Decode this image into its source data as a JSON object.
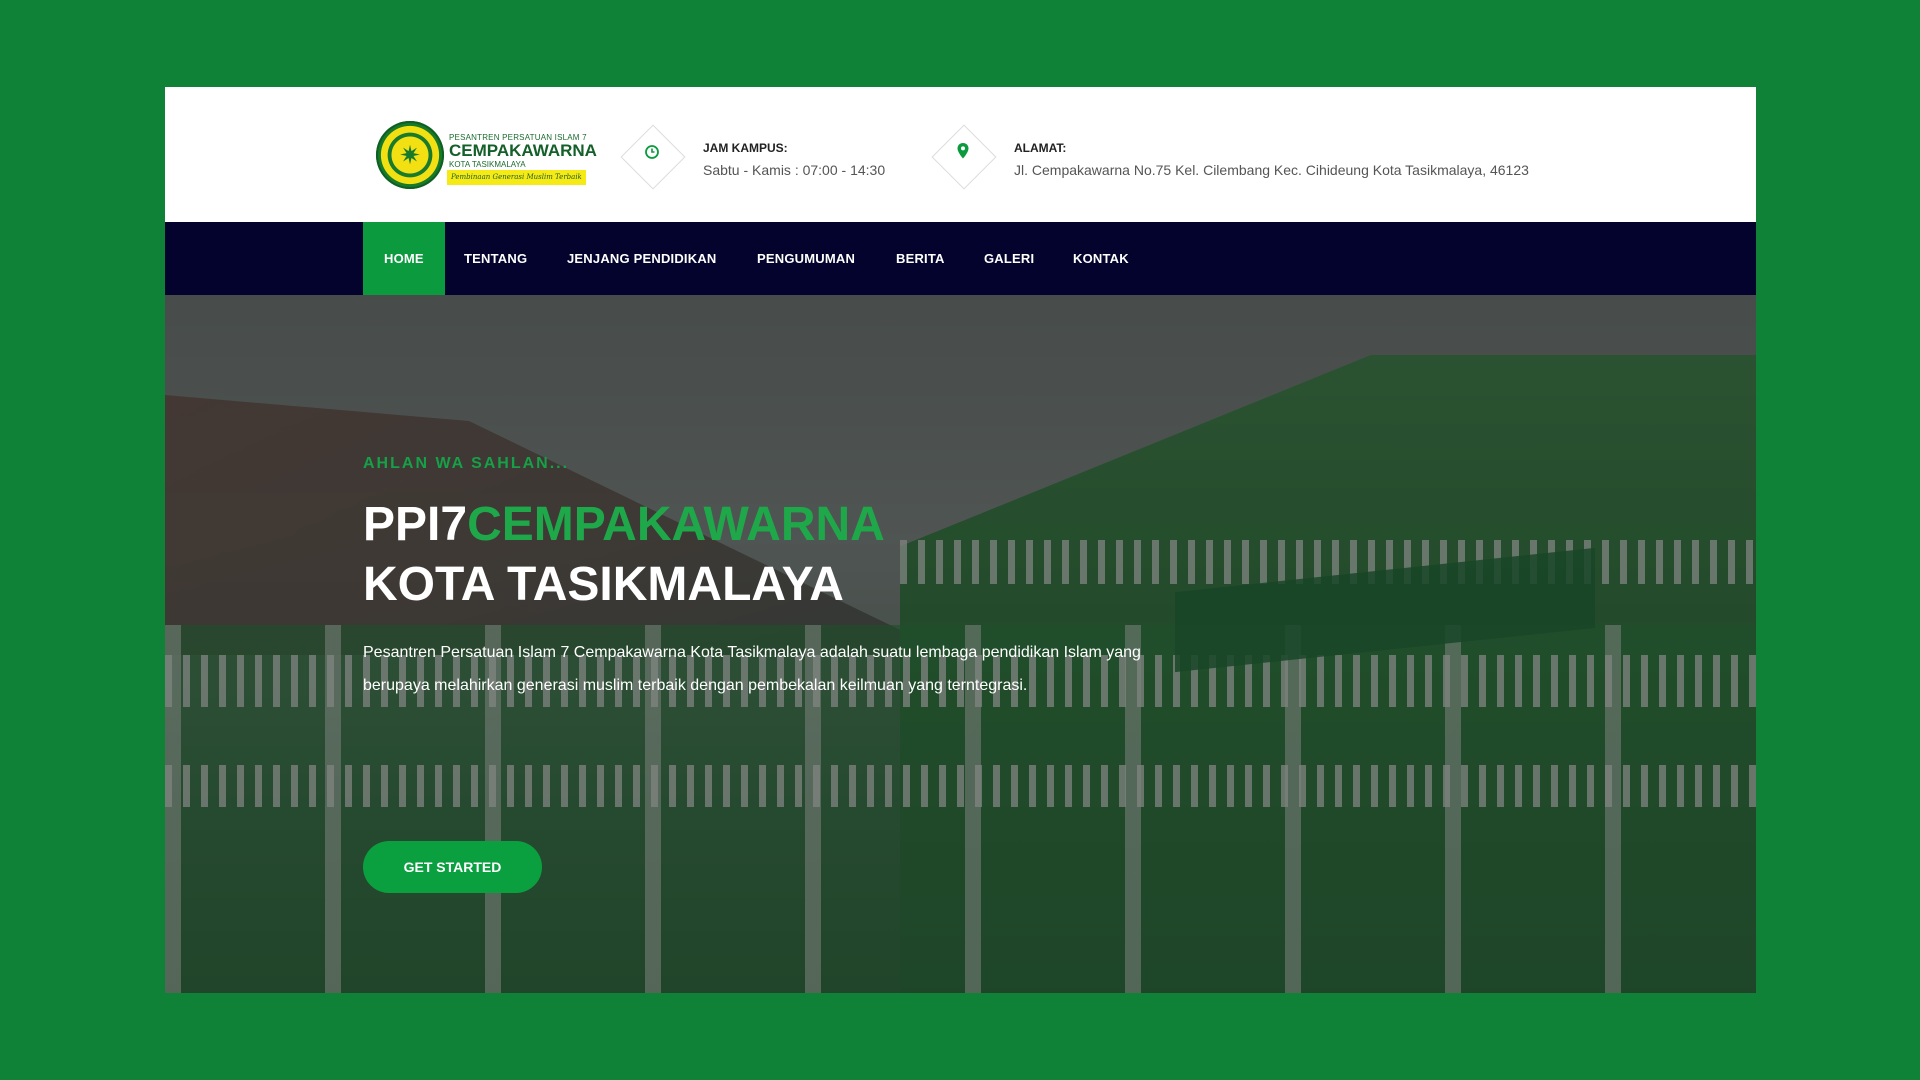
{
  "logo": {
    "line1": "PESANTREN PERSATUAN ISLAM 7",
    "line2": "CEMPAKAWARNA",
    "line3": "KOTA TASIKMALAYA",
    "tagline": "Pembinaan Generasi Muslim Terbaik"
  },
  "header": {
    "campus_hours": {
      "label": "JAM KAMPUS:",
      "value": "Sabtu - Kamis : 07:00 - 14:30",
      "icon": "clock-icon"
    },
    "address": {
      "label": "ALAMAT:",
      "value": "Jl. Cempakawarna No.75 Kel. Cilembang Kec. Cihideung Kota Tasikmalaya, 46123",
      "icon": "map-pin-icon"
    }
  },
  "nav": {
    "items": [
      {
        "label": "HOME",
        "active": true
      },
      {
        "label": "TENTANG"
      },
      {
        "label": "JENJANG PENDIDIKAN"
      },
      {
        "label": "PENGUMUMAN"
      },
      {
        "label": "BERITA"
      },
      {
        "label": "GALERI"
      },
      {
        "label": "KONTAK"
      }
    ]
  },
  "hero": {
    "eyebrow": "AHLAN WA SAHLAN...",
    "title_part1": "PPI7",
    "title_part2": "CEMPAKAWARNA",
    "title_line2": "KOTA TASIKMALAYA",
    "description": "Pesantren Persatuan Islam 7 Cempakawarna Kota Tasikmalaya adalah suatu lembaga pendidikan Islam yang berupaya melahirkan generasi muslim terbaik dengan pembekalan keilmuan yang terntegrasi.",
    "cta_label": "GET STARTED"
  },
  "colors": {
    "page_background": "#0f8237",
    "nav_background": "#03032e",
    "accent_green": "#0ba03f"
  }
}
